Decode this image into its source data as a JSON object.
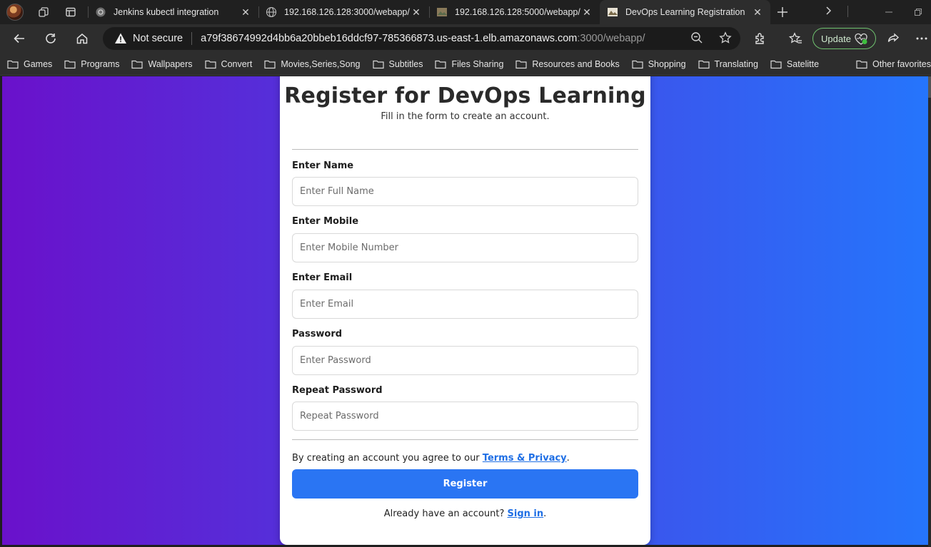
{
  "tabs": [
    {
      "title": "Jenkins kubectl integration",
      "favicon": "gear-icon",
      "active": false
    },
    {
      "title": "192.168.126.128:3000/webapp/",
      "favicon": "globe-icon",
      "active": false
    },
    {
      "title": "192.168.126.128:5000/webapp/",
      "favicon": "image-icon",
      "active": false
    },
    {
      "title": "DevOps Learning Registration",
      "favicon": "image-icon",
      "active": true
    }
  ],
  "toolbar": {
    "security_label": "Not secure",
    "url_host": "a79f38674992d4bb6a20bbeb16ddcf97-785366873.us-east-1.elb.amazonaws.com",
    "url_path": ":3000/webapp/",
    "update_label": "Update"
  },
  "bookmarks": [
    "Games",
    "Programs",
    "Wallpapers",
    "Convert",
    "Movies,Series,Song",
    "Subtitles",
    "Files Sharing",
    "Resources and Books",
    "Shopping",
    "Translating",
    "Satelitte"
  ],
  "other_favorites": "Other favorites",
  "form": {
    "title": "Register for DevOps Learning",
    "subtitle": "Fill in the form to create an account.",
    "fields": [
      {
        "label": "Enter Name",
        "placeholder": "Enter Full Name",
        "value": ""
      },
      {
        "label": "Enter Mobile",
        "placeholder": "Enter Mobile Number",
        "value": ""
      },
      {
        "label": "Enter Email",
        "placeholder": "Enter Email",
        "value": ""
      },
      {
        "label": "Password",
        "placeholder": "Enter Password",
        "value": ""
      },
      {
        "label": "Repeat Password",
        "placeholder": "Repeat Password",
        "value": ""
      }
    ],
    "terms_prefix": "By creating an account you agree to our ",
    "terms_link": "Terms & Privacy",
    "terms_suffix": ".",
    "register_label": "Register",
    "signin_prefix": "Already have an account? ",
    "signin_link": "Sign in",
    "signin_suffix": "."
  },
  "colors": {
    "gradient_start": "#6a11cb",
    "gradient_end": "#2575fc",
    "button": "#2a75f3",
    "link": "#1f6fe5"
  }
}
